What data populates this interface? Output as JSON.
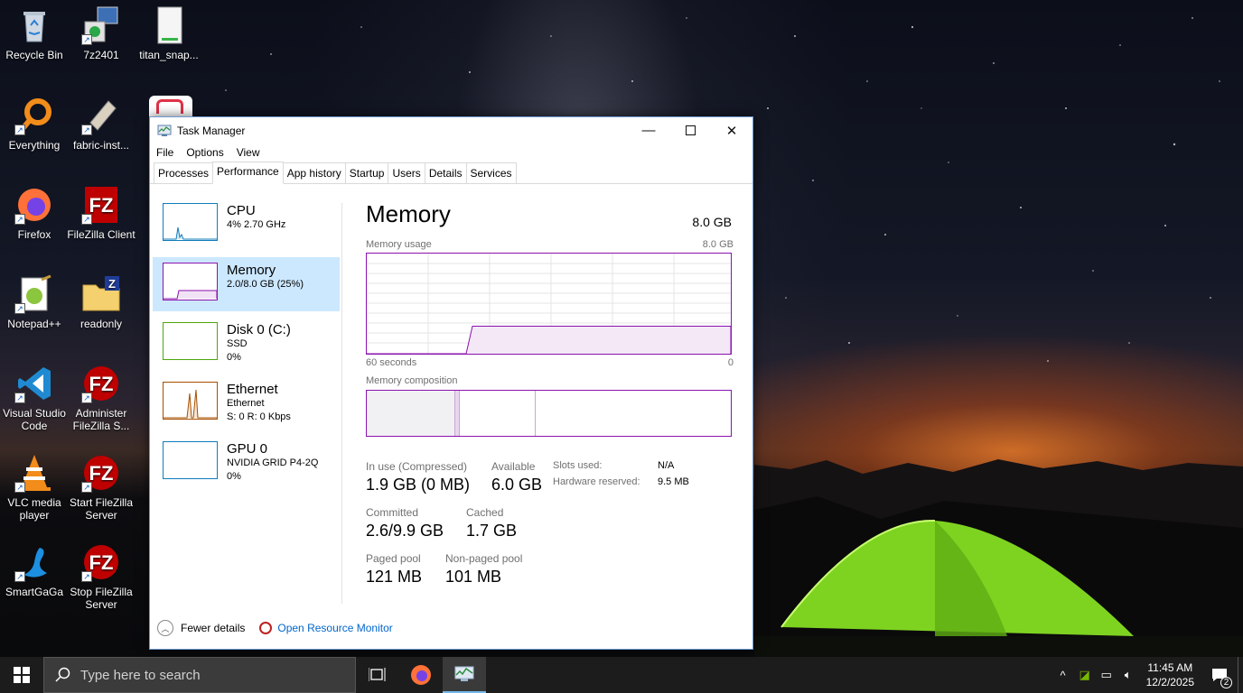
{
  "desktop": {
    "icons": [
      {
        "label": "Recycle Bin"
      },
      {
        "label": "7z2401"
      },
      {
        "label": "titan_snap..."
      },
      {
        "label": "Everything"
      },
      {
        "label": "fabric-inst..."
      },
      {
        "label": "Firefox"
      },
      {
        "label": "FileZilla Client"
      },
      {
        "label": "Notepad++"
      },
      {
        "label": "readonly"
      },
      {
        "label": "Visual Studio Code"
      },
      {
        "label": "Administer FileZilla S..."
      },
      {
        "label": "VLC media player"
      },
      {
        "label": "Start FileZilla Server"
      },
      {
        "label": "SmartGaGa"
      },
      {
        "label": "Stop FileZilla Server"
      }
    ]
  },
  "window": {
    "title": "Task Manager",
    "menu": [
      "File",
      "Options",
      "View"
    ],
    "tabs": [
      "Processes",
      "Performance",
      "App history",
      "Startup",
      "Users",
      "Details",
      "Services"
    ],
    "active_tab": "Performance"
  },
  "sidebar": {
    "items": [
      {
        "name": "CPU",
        "line1": "4%  2.70 GHz",
        "line2": "",
        "color": "#117dbb"
      },
      {
        "name": "Memory",
        "line1": "2.0/8.0 GB (25%)",
        "line2": "",
        "color": "#8b12ae"
      },
      {
        "name": "Disk 0 (C:)",
        "line1": "SSD",
        "line2": "0%",
        "color": "#4da60c"
      },
      {
        "name": "Ethernet",
        "line1": "Ethernet",
        "line2": "S: 0 R: 0 Kbps",
        "color": "#a74f01"
      },
      {
        "name": "GPU 0",
        "line1": "NVIDIA GRID P4-2Q",
        "line2": "0%",
        "color": "#117dbb"
      }
    ]
  },
  "memory": {
    "title": "Memory",
    "total": "8.0 GB",
    "usage_label": "Memory usage",
    "usage_max": "8.0 GB",
    "axis_left": "60 seconds",
    "axis_right": "0",
    "composition_label": "Memory composition",
    "usage_fraction": 0.25,
    "stats": {
      "in_use_label": "In use (Compressed)",
      "in_use_value": "1.9 GB (0 MB)",
      "available_label": "Available",
      "available_value": "6.0 GB",
      "committed_label": "Committed",
      "committed_value": "2.6/9.9 GB",
      "cached_label": "Cached",
      "cached_value": "1.7 GB",
      "paged_label": "Paged pool",
      "paged_value": "121 MB",
      "nonpaged_label": "Non-paged pool",
      "nonpaged_value": "101 MB",
      "slots_label": "Slots used:",
      "slots_value": "N/A",
      "hw_label": "Hardware reserved:",
      "hw_value": "9.5 MB"
    }
  },
  "footer": {
    "fewer_details": "Fewer details",
    "resource_monitor": "Open Resource Monitor"
  },
  "taskbar": {
    "search_placeholder": "Type here to search",
    "time": "11:45 AM",
    "date": "12/2/2025",
    "notification_count": "2"
  },
  "colors": {
    "memory_accent": "#8b12ae",
    "selected_bg": "#cce8ff",
    "link": "#0066cc"
  }
}
